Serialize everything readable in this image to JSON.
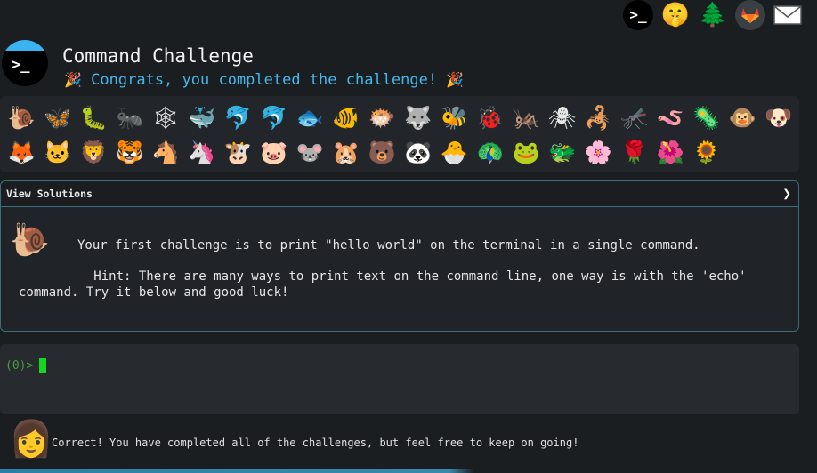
{
  "top_icons": [
    {
      "name": "terminal-icon",
      "glyph": ">_"
    },
    {
      "name": "shushing-face-icon",
      "glyph": "🤫"
    },
    {
      "name": "evergreen-tree-icon",
      "glyph": "🌲"
    },
    {
      "name": "gitlab-icon",
      "glyph": ""
    },
    {
      "name": "envelope-icon",
      "glyph": ""
    }
  ],
  "header": {
    "title": "Command Challenge",
    "subtitle": "Congrats, you completed the challenge!",
    "confetti": "🎉"
  },
  "animals_row1": [
    "🐌",
    "🦋",
    "🐛",
    "🐜",
    "🕸",
    "🐳",
    "🐬",
    "🐬",
    "🐟",
    "🐠",
    "🐡",
    "🐺",
    "🐝",
    "🐞",
    "🦗",
    "🕷",
    "🦂",
    "🦟",
    "🪱",
    "🦠",
    "🐵",
    "🐶"
  ],
  "animals_row2": [
    "🦊",
    "🐱",
    "🦁",
    "🐯",
    "🐴",
    "🦄",
    "🐮",
    "🐷",
    "🐭",
    "🐹",
    "🐻",
    "🐼",
    "🐣",
    "🦚",
    "🐸",
    "🐲",
    "🌸",
    "🌹",
    "🌺",
    "🌻"
  ],
  "solutions": {
    "title": "View Solutions",
    "chevron": "❯",
    "challenge_icon": "🐌",
    "challenge_text": "Your first challenge is to print \"hello world\" on the terminal in a single command.",
    "hint_text": "Hint: There are many ways to print text on the command line, one way is with the 'echo' command. Try it below and good luck!"
  },
  "terminal": {
    "prompt": "(0)>"
  },
  "footer": {
    "avatar": "👩",
    "message": "Correct! You have completed all of the challenges, but feel free to keep on going!"
  },
  "progress": 0.58,
  "colors": {
    "background": "#1b1e21",
    "accent": "#43b6ea",
    "terminal_cursor": "#16d61f",
    "panel_border": "#3c6d7a"
  }
}
